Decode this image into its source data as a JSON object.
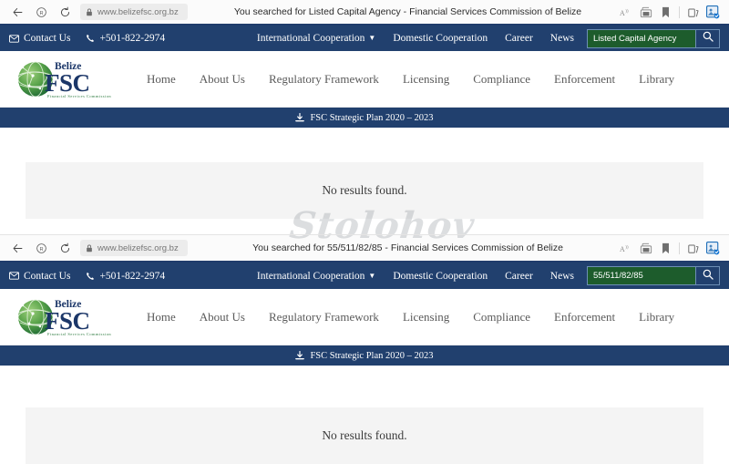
{
  "windows": [
    {
      "browser": {
        "url": "www.belizefsc.org.bz",
        "tab_title": "You searched for Listed Capital Agency - Financial Services Commission of Belize",
        "back_label": "Back",
        "refresh_label": "Refresh",
        "blocked_label": "Tracking prevention",
        "lock_label": "Site information",
        "read_aloud_label": "Read aloud",
        "wallet_label": "Wallet",
        "favorites_label": "Add to favorites",
        "collections_label": "Collections",
        "profile_label": "Profile"
      },
      "topbar": {
        "contact_label": "Contact Us",
        "phone_label": "+501-822-2974",
        "links": [
          {
            "label": "International Cooperation",
            "has_caret": true
          },
          {
            "label": "Domestic Cooperation",
            "has_caret": false
          },
          {
            "label": "Career",
            "has_caret": false
          },
          {
            "label": "News",
            "has_caret": false
          }
        ],
        "search_value": "Listed Capital Agency",
        "search_placeholder": "Search",
        "search_button_label": "Search"
      },
      "logo": {
        "brand_top": "Belize",
        "brand_main": "FSC",
        "brand_sub": "Financial Services Commission"
      },
      "mainnav": [
        "Home",
        "About Us",
        "Regulatory Framework",
        "Licensing",
        "Compliance",
        "Enforcement",
        "Library"
      ],
      "strategic_bar": "FSC Strategic Plan 2020 – 2023",
      "content": {
        "message": "No results found."
      }
    },
    {
      "browser": {
        "url": "www.belizefsc.org.bz",
        "tab_title": "You searched for 55/511/82/85 - Financial Services Commission of Belize",
        "back_label": "Back",
        "refresh_label": "Refresh",
        "blocked_label": "Tracking prevention",
        "lock_label": "Site information",
        "read_aloud_label": "Read aloud",
        "wallet_label": "Wallet",
        "favorites_label": "Add to favorites",
        "collections_label": "Collections",
        "profile_label": "Profile"
      },
      "topbar": {
        "contact_label": "Contact Us",
        "phone_label": "+501-822-2974",
        "links": [
          {
            "label": "International Cooperation",
            "has_caret": true
          },
          {
            "label": "Domestic Cooperation",
            "has_caret": false
          },
          {
            "label": "Career",
            "has_caret": false
          },
          {
            "label": "News",
            "has_caret": false
          }
        ],
        "search_value": "55/511/82/85",
        "search_placeholder": "Search",
        "search_button_label": "Search"
      },
      "logo": {
        "brand_top": "Belize",
        "brand_main": "FSC",
        "brand_sub": "Financial Services Commission"
      },
      "mainnav": [
        "Home",
        "About Us",
        "Regulatory Framework",
        "Licensing",
        "Compliance",
        "Enforcement",
        "Library"
      ],
      "strategic_bar": "FSC Strategic Plan 2020 – 2023",
      "content": {
        "message": "No results found."
      }
    }
  ],
  "watermark": {
    "text": "Stolohov"
  },
  "colors": {
    "navy": "#21406e",
    "search_green": "#1d5c2c",
    "panel_gray": "#f4f4f4",
    "logo_green": "#4e9b45",
    "logo_navy": "#1b3668"
  }
}
